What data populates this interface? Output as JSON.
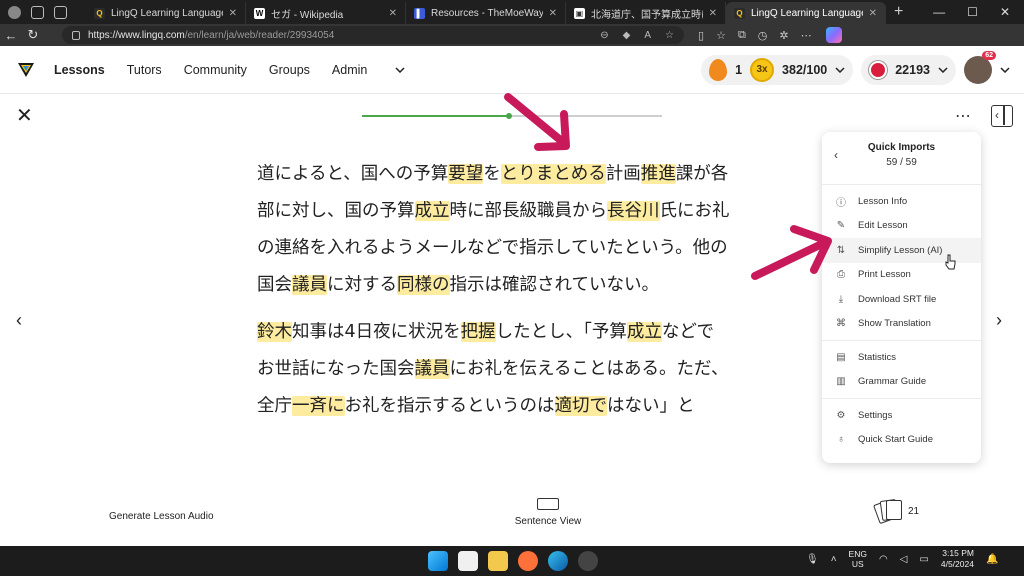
{
  "browser": {
    "tabs": [
      {
        "title": "LingQ Learning Languages Simp",
        "fav": "Q",
        "fav_bg": "#2b2b2b",
        "fav_fg": "#f5c518",
        "active": false
      },
      {
        "title": "セガ - Wikipedia",
        "fav": "W",
        "fav_bg": "#ffffff",
        "fav_fg": "#000000",
        "active": false
      },
      {
        "title": "Resources - TheMoeWay",
        "fav": "▌",
        "fav_bg": "#3b5bdb",
        "fav_fg": "#ffffff",
        "active": false
      },
      {
        "title": "北海道庁、国予算成立時に自民・",
        "fav": "▣",
        "fav_bg": "#ffffff",
        "fav_fg": "#333333",
        "active": false
      },
      {
        "title": "LingQ Learning Languages Simp",
        "fav": "Q",
        "fav_bg": "#2b2b2b",
        "fav_fg": "#f5c518",
        "active": true
      }
    ],
    "new_tab_icon": "plus-icon",
    "url_host": "https://www.lingq.com",
    "url_path": "/en/learn/ja/web/reader/29934054"
  },
  "header": {
    "nav": [
      "Lessons",
      "Tutors",
      "Community",
      "Groups",
      "Admin"
    ],
    "streak": "1",
    "multiplier": "3x",
    "daily_goal": "382/100",
    "coins": "22193",
    "avatar_badge": "62"
  },
  "reader": {
    "progress_fraction": 0.49,
    "paragraphs": [
      [
        [
          {
            "t": "道によると、国への予算"
          },
          {
            "t": "要望",
            "h": true
          },
          {
            "t": "を"
          },
          {
            "t": "とりまとめる",
            "h": true
          },
          {
            "t": "計画"
          },
          {
            "t": "推進",
            "h": true
          },
          {
            "t": "課が各"
          }
        ],
        [
          {
            "t": "部に対し、国の予算"
          },
          {
            "t": "成立",
            "h": true
          },
          {
            "t": "時に部長級職員から"
          },
          {
            "t": "長谷川",
            "h": true
          },
          {
            "t": "氏にお礼"
          }
        ],
        [
          {
            "t": "の連絡を入れるようメールなどで指示していたという。他の"
          }
        ],
        [
          {
            "t": "国会"
          },
          {
            "t": "議員",
            "h": true
          },
          {
            "t": "に対する"
          },
          {
            "t": "同様の",
            "h": true
          },
          {
            "t": "指示は確認されていない。"
          }
        ]
      ],
      [
        [
          {
            "t": "鈴木",
            "h": true
          },
          {
            "t": "知事は4日夜に状況を"
          },
          {
            "t": "把握",
            "h": true
          },
          {
            "t": "したとし、「予算"
          },
          {
            "t": "成立",
            "h": true
          },
          {
            "t": "などで"
          }
        ],
        [
          {
            "t": "お世話になった国会"
          },
          {
            "t": "議員",
            "h": true
          },
          {
            "t": "にお礼を伝えることはある。ただ、"
          }
        ],
        [
          {
            "t": "全庁"
          },
          {
            "t": "一斉に",
            "h": true
          },
          {
            "t": "お礼を指示するというのは"
          },
          {
            "t": "適切で",
            "h": true
          },
          {
            "t": "はない」と"
          }
        ]
      ]
    ],
    "generate_audio": "Generate Lesson Audio",
    "sentence_view": "Sentence View",
    "cards_count": "21"
  },
  "menu": {
    "title": "Quick Imports",
    "current": "59",
    "total": "59",
    "groups": [
      [
        {
          "label": "Lesson Info",
          "icon": "info-icon",
          "glyph": "ⓘ"
        },
        {
          "label": "Edit Lesson",
          "icon": "pencil-icon",
          "glyph": "✎"
        },
        {
          "label": "Simplify Lesson (AI)",
          "icon": "sort-icon",
          "glyph": "⇅"
        },
        {
          "label": "Print Lesson",
          "icon": "printer-icon",
          "glyph": "⎙"
        },
        {
          "label": "Download SRT file",
          "icon": "download-icon",
          "glyph": "⤓"
        },
        {
          "label": "Show Translation",
          "icon": "translate-icon",
          "glyph": "⌘"
        }
      ],
      [
        {
          "label": "Statistics",
          "icon": "chart-icon",
          "glyph": "▤"
        },
        {
          "label": "Grammar Guide",
          "icon": "book-icon",
          "glyph": "▥"
        }
      ],
      [
        {
          "label": "Settings",
          "icon": "gear-icon",
          "glyph": "⚙"
        },
        {
          "label": "Quick Start Guide",
          "icon": "lightbulb-icon",
          "glyph": "♁"
        }
      ]
    ]
  },
  "taskbar": {
    "lang1": "ENG",
    "lang2": "US",
    "time": "3:15 PM",
    "date": "4/5/2024"
  },
  "colors": {
    "highlight": "#fdeba0",
    "annotation_arrow": "#c8195a",
    "progress": "#4aa64a"
  }
}
